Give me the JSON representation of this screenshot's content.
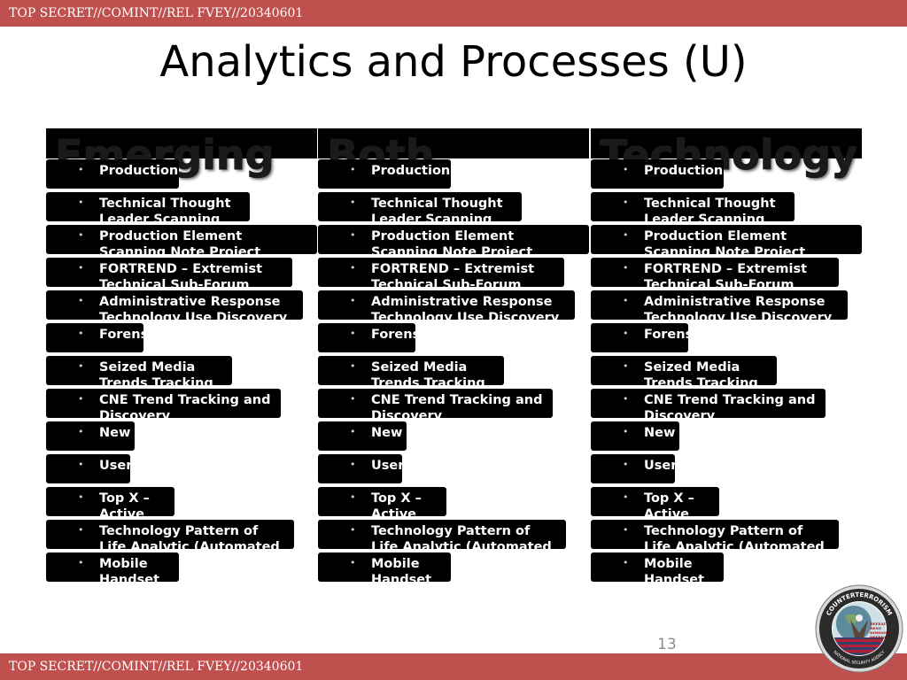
{
  "banner": {
    "top_text": "TOP SECRET//COMINT//REL FVEY//20340601",
    "bottom_text": "TOP SECRET//COMINT//REL FVEY//20340601"
  },
  "slide": {
    "title": "Analytics and Processes (U)",
    "page_number": "13"
  },
  "columns": [
    {
      "header": "Emerging",
      "items": [
        "Production",
        "Technical Thought Leader Scanning",
        "Production Element Scanning Note Project",
        "FORTREND – Extremist Technical Sub-Forum",
        "Administrative Response Technology Use Discovery",
        "Forensic",
        "Seized Media Trends Tracking",
        "CNE Trend Tracking and Discovery",
        "New",
        "User",
        "Top X – Active",
        "Technology Pattern of Life Analytic (Automated",
        "Mobile Handset"
      ]
    },
    {
      "header": "Both",
      "items": [
        "Production",
        "Technical Thought Leader Scanning",
        "Production Element Scanning Note Project",
        "FORTREND – Extremist Technical Sub-Forum",
        "Administrative Response Technology Use Discovery",
        "Forensic",
        "Seized Media Trends Tracking",
        "CNE Trend Tracking and Discovery",
        "New",
        "User",
        "Top X – Active",
        "Technology Pattern of Life Analytic (Automated",
        "Mobile Handset"
      ]
    },
    {
      "header": "Technology",
      "items": [
        "Production",
        "Technical Thought Leader Scanning",
        "Production Element Scanning Note Project",
        "FORTREND – Extremist Technical Sub-Forum",
        "Administrative Response Technology Use Discovery",
        "Forensic",
        "Seized Media Trends Tracking",
        "CNE Trend Tracking and Discovery",
        "New",
        "User",
        "Top X – Active",
        "Technology Pattern of Life Analytic (Automated",
        "Mobile Handset"
      ]
    }
  ],
  "seal": {
    "ring_text": "COUNTERTERRORISM",
    "lower_text": "NATIONAL SECURITY AGENCY",
    "center_text": [
      "DEFEAT",
      "DENY",
      "DIMINISH",
      "DEFEND"
    ],
    "colors": {
      "ring": "#2b2b2b",
      "globe": "#5d8a9c",
      "flag_red": "#b22234",
      "flag_blue": "#3c3b6e"
    }
  },
  "colors": {
    "banner": "#c0504d",
    "pill": "#000000",
    "page_number": "#8c8c8c"
  }
}
